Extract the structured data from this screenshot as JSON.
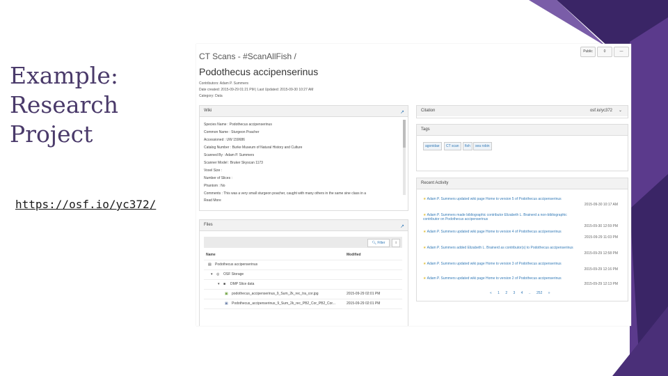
{
  "slide": {
    "title_lines": [
      "Example:",
      "Research",
      "Project"
    ],
    "link": "https://osf.io/yc372/"
  },
  "colors": {
    "accent_purple": "#5b3a8c",
    "dark_purple": "#3a2566",
    "link_blue": "#337ab7"
  },
  "osf": {
    "breadcrumb": "CT Scans - #ScanAllFish  /",
    "project_title": "Podothecus accipenserinus",
    "contributors": "Contributors: Adam P. Summers",
    "dates": "Date created: 2015-09-29 01:21 PM | Last Updated: 2015-09-30 10:27 AM",
    "category": "Category: Data",
    "buttons": {
      "public": "Public",
      "count": "0",
      "menu": "—"
    },
    "wiki": {
      "title": "Wiki",
      "lines": [
        "Species Name : Podothecus accipenserinus",
        "Common Name : Sturgeon Poacher",
        "Accessioned : UW 159686",
        "Catalog Number : Burke Museum of Natural History and Culture",
        "Scanned By : Adam P. Summers",
        "Scanner Model : Bruker Skyscan 1173",
        "Voxel Size :",
        "Number of Slices :",
        "Phantom : No",
        "Comments : This was a very small sturgeon poacher, caught with many others in the same sine class in a"
      ],
      "read_more": "Read More"
    },
    "files": {
      "title": "Files",
      "filter_label": "Filter",
      "columns": {
        "name": "Name",
        "modified": "Modified"
      },
      "rows": [
        {
          "name": "Podothecus accipenserinus",
          "modified": ""
        },
        {
          "name": "OSF Storage",
          "modified": ""
        },
        {
          "name": "DMP Slice data",
          "modified": ""
        },
        {
          "name": "podothecus_accipenserinus_9_Sum_2k_rec_tra_cor.jpg",
          "modified": "2015-09-29 02:01 PM"
        },
        {
          "name": "Podothecus_accipenserinus_9_Sum_2k_rec_PB2_Cor_PB2_Cor...",
          "modified": "2015-09-29 02:01 PM"
        }
      ]
    },
    "citation": {
      "title": "Citation",
      "value": "osf.io/yc372"
    },
    "tags": {
      "title": "Tags",
      "items": [
        "agonidae",
        "CT scan",
        "fish",
        "sea robin"
      ]
    },
    "activity": {
      "title": "Recent Activity",
      "items": [
        {
          "text": "Adam P. Summers updated wiki page Home to version 5 of Podothecus accipenserinus",
          "date": "2015-09-30 10:17 AM"
        },
        {
          "text": "Adam P. Summers made bibliographic contributor Elizabeth L. Brainerd a non-bibliographic contributor on Podothecus accipenserinus",
          "date": "2015-09-30 12:59 PM"
        },
        {
          "text": "Adam P. Summers updated wiki page Home to version 4 of Podothecus accipenserinus",
          "date": "2015-09-29 11:03 PM"
        },
        {
          "text": "Adam P. Summers added Elizabeth L. Brainerd as contributor(s) to Podothecus accipenserinus",
          "date": "2015-09-29 12:58 PM"
        },
        {
          "text": "Adam P. Summers updated wiki page Home to version 3 of Podothecus accipenserinus",
          "date": "2015-09-29 12:16 PM"
        },
        {
          "text": "Adam P. Summers updated wiki page Home to version 2 of Podothecus accipenserinus",
          "date": "2015-09-29 12:13 PM"
        }
      ],
      "pager": "« 1 2 3 4 .. 252 »"
    }
  }
}
